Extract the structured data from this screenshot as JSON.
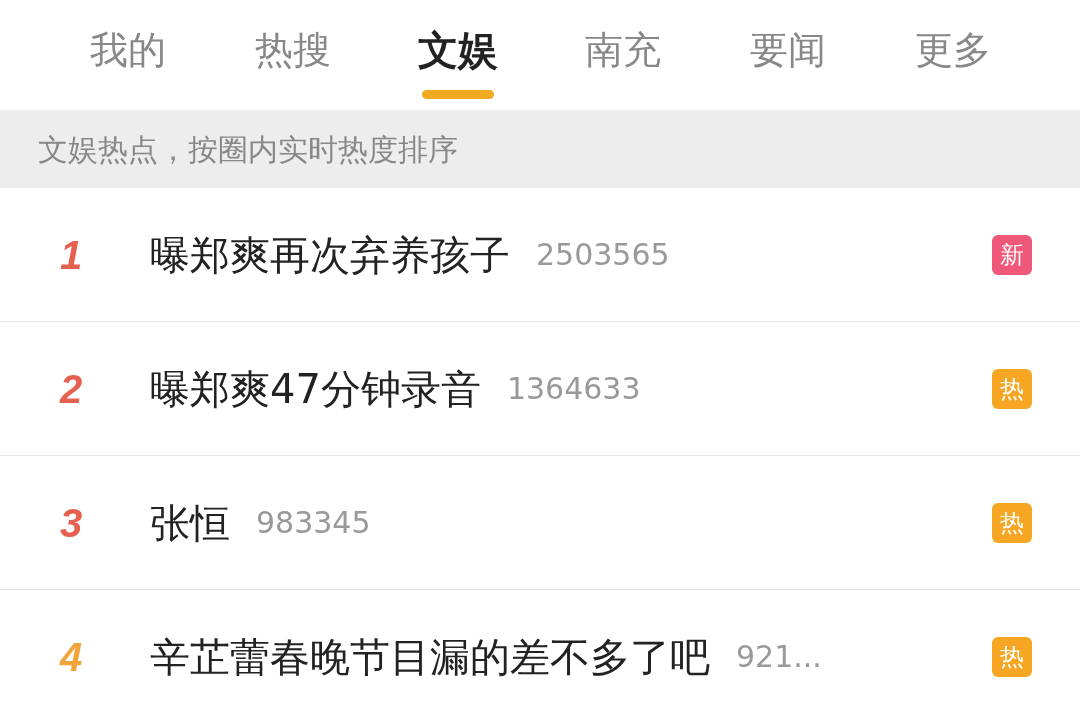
{
  "tabs": [
    {
      "label": "我的",
      "selected": false
    },
    {
      "label": "热搜",
      "selected": false
    },
    {
      "label": "文娱",
      "selected": true
    },
    {
      "label": "南充",
      "selected": false
    },
    {
      "label": "要闻",
      "selected": false
    },
    {
      "label": "更多",
      "selected": false
    }
  ],
  "subtitle": "文娱热点，按圈内实时热度排序",
  "items": [
    {
      "rank": "1",
      "color": "#e5604f",
      "title": "曝郑爽再次弃养孩子",
      "count": "2503565",
      "badge": {
        "kind": "new",
        "label": "新"
      }
    },
    {
      "rank": "2",
      "color": "#e5604f",
      "title": "曝郑爽47分钟录音",
      "count": "1364633",
      "badge": {
        "kind": "hot",
        "label": "热"
      }
    },
    {
      "rank": "3",
      "color": "#e5604f",
      "title": "张恒",
      "count": "983345",
      "badge": {
        "kind": "hot",
        "label": "热"
      }
    },
    {
      "rank": "4",
      "color": "#f0a43a",
      "title": "辛芷蕾春晚节目漏的差不多了吧",
      "count": "921...",
      "badge": {
        "kind": "hot",
        "label": "热"
      }
    }
  ]
}
